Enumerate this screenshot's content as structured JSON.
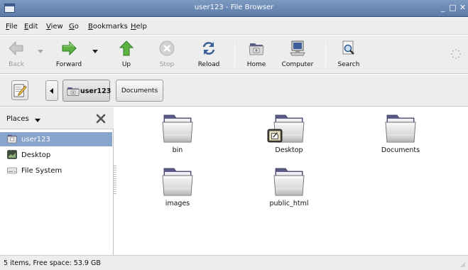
{
  "window": {
    "title": "user123 - File Browser",
    "controls": {
      "minimize": "_",
      "maximize": "□",
      "close": "✕"
    }
  },
  "menubar": {
    "items": [
      "File",
      "Edit",
      "View",
      "Go",
      "Bookmarks",
      "Help"
    ]
  },
  "toolbar": {
    "back": {
      "label": "Back",
      "icon": "back-arrow-icon",
      "enabled": false
    },
    "forward": {
      "label": "Forward",
      "icon": "forward-arrow-icon",
      "enabled": true
    },
    "up": {
      "label": "Up",
      "icon": "up-arrow-icon",
      "enabled": true
    },
    "stop": {
      "label": "Stop",
      "icon": "stop-icon",
      "enabled": false
    },
    "reload": {
      "label": "Reload",
      "icon": "reload-icon",
      "enabled": true
    },
    "home": {
      "label": "Home",
      "icon": "home-folder-icon",
      "enabled": true
    },
    "computer": {
      "label": "Computer",
      "icon": "computer-icon",
      "enabled": true
    },
    "search": {
      "label": "Search",
      "icon": "search-icon",
      "enabled": true
    }
  },
  "location": {
    "crumbs": [
      {
        "label": "user123",
        "active": true
      },
      {
        "label": "Documents",
        "active": false
      }
    ]
  },
  "sidebar": {
    "selector_label": "Places",
    "items": [
      {
        "label": "user123",
        "icon": "home-folder-icon",
        "selected": true
      },
      {
        "label": "Desktop",
        "icon": "desktop-icon",
        "selected": false
      },
      {
        "label": "File System",
        "icon": "drive-icon",
        "selected": false
      }
    ]
  },
  "files": [
    {
      "name": "bin",
      "icon": "folder-icon"
    },
    {
      "name": "Desktop",
      "icon": "folder-icon",
      "emblem": "desktop-emblem-icon"
    },
    {
      "name": "Documents",
      "icon": "folder-icon"
    },
    {
      "name": "images",
      "icon": "folder-icon"
    },
    {
      "name": "public_html",
      "icon": "folder-icon"
    }
  ],
  "status": {
    "text": "5 items, Free space: 53.9 GB"
  },
  "colors": {
    "titlebar": "#6b89b4",
    "selection": "#86a4cc",
    "folder_tab": "#5c5c88",
    "folder_body": "#dcdcdc"
  }
}
